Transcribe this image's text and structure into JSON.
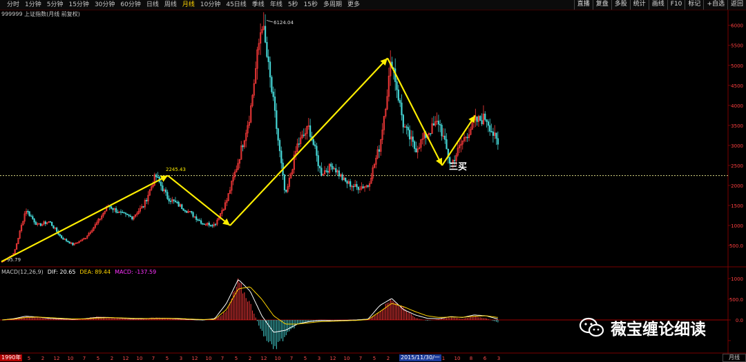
{
  "toolbar": {
    "tabs": [
      "分时",
      "1分钟",
      "5分钟",
      "15分钟",
      "30分钟",
      "60分钟",
      "日线",
      "周线",
      "月线",
      "10分钟",
      "45日线",
      "季线",
      "年线",
      "5秒",
      "15秒",
      "多周期",
      "更多"
    ],
    "active_tab": "月线",
    "right_buttons": [
      "直播",
      "复盘",
      "多股",
      "统计",
      "画线",
      "F10",
      "标记",
      "+自选",
      "返回"
    ]
  },
  "chart_title": "999999 上证指数(月线 前复权)",
  "macd_legend": {
    "label": "MACD(12,26,9)",
    "dif": "DIF: 20.65",
    "dea": "DEA: 89.44",
    "macd": "MACD: -137.59"
  },
  "watermark": "薇宝缠论细读",
  "period_label": "月线",
  "start_label": "1990年",
  "cursor_date": "2015/11/30/一",
  "colors": {
    "up": "#ff3b3b",
    "down": "#45d3d3",
    "arrow": "#ffee00",
    "dif": "#ffffff",
    "dea": "#ffd400",
    "macd_text": "#ff33ff",
    "grid": "#7a0000"
  },
  "chart_data": [
    {
      "type": "candlestick",
      "title": "999999 上证指数(月线 前复权)",
      "yticks": [
        500,
        1000,
        1500,
        2000,
        2500,
        3000,
        3500,
        4000,
        4500,
        5000,
        5500,
        6000
      ],
      "ytick_labels": [
        "500.0",
        "1000",
        "1500",
        "2000",
        "2500",
        "3000",
        "3500",
        "4000",
        "4500",
        "5000",
        "5500",
        "6000"
      ],
      "ylim": [
        0,
        6150
      ],
      "xtick_labels": [
        "1990年",
        "7",
        "5",
        "2",
        "12",
        "10",
        "7",
        "5",
        "2",
        "12",
        "10",
        "7",
        "5",
        "3",
        "12",
        "10",
        "7",
        "5",
        "2",
        "12",
        "10",
        "7",
        "5",
        "3",
        "12",
        "10",
        "7",
        "5",
        "2",
        "12",
        "2015/11/30/一",
        "3",
        "1",
        "10",
        "8",
        "6",
        "3"
      ],
      "price_path": [
        96,
        300,
        1400,
        1000,
        1100,
        700,
        520,
        680,
        1050,
        1500,
        1300,
        1200,
        1500,
        2245,
        1700,
        1500,
        1300,
        1050,
        1020,
        1600,
        2600,
        3800,
        6124,
        4000,
        1700,
        3000,
        3450,
        2300,
        2500,
        2100,
        1950,
        2000,
        3000,
        5178,
        3500,
        2900,
        3300,
        3600,
        2500,
        3100,
        3580,
        3700,
        3000
      ],
      "annotations": [
        {
          "text": "6124.04",
          "value": 6124.04
        },
        {
          "text": "2245.43",
          "value": 2245.43
        },
        {
          "text": "95.79",
          "value": 95.79
        },
        {
          "text": "三买"
        }
      ],
      "reference_line": 2245.43,
      "arrows_path": [
        96,
        2245,
        1000,
        5178,
        2500,
        3750
      ]
    },
    {
      "type": "bar",
      "title": "MACD(12,26,9)",
      "yticks": [
        -500,
        0,
        500,
        1000
      ],
      "ytick_labels": [
        "",
        "0.0",
        "500.0",
        "1000"
      ],
      "ylim": [
        -800,
        1100
      ],
      "series": [
        {
          "name": "DIF"
        },
        {
          "name": "DEA"
        },
        {
          "name": "MACD"
        }
      ],
      "macd_path": [
        0,
        40,
        80,
        60,
        30,
        20,
        10,
        40,
        80,
        60,
        40,
        20,
        30,
        60,
        40,
        20,
        0,
        -10,
        20,
        200,
        900,
        400,
        -300,
        -700,
        -400,
        -100,
        -50,
        -30,
        -20,
        -10,
        -20,
        10,
        200,
        500,
        300,
        50,
        -20,
        20,
        60,
        30,
        90,
        40,
        -60
      ],
      "dif_path": [
        0,
        30,
        90,
        70,
        40,
        25,
        15,
        30,
        60,
        60,
        45,
        30,
        30,
        40,
        40,
        25,
        10,
        0,
        30,
        400,
        980,
        700,
        100,
        -300,
        -250,
        -100,
        -40,
        -10,
        -20,
        -10,
        0,
        20,
        350,
        520,
        250,
        120,
        40,
        30,
        80,
        60,
        120,
        100,
        20
      ],
      "dea_path": [
        0,
        20,
        60,
        70,
        55,
        40,
        25,
        25,
        45,
        55,
        50,
        40,
        35,
        35,
        40,
        35,
        20,
        10,
        15,
        250,
        750,
        800,
        500,
        100,
        -100,
        -100,
        -70,
        -40,
        -30,
        -20,
        -10,
        10,
        200,
        400,
        320,
        200,
        100,
        60,
        70,
        65,
        90,
        100,
        60
      ]
    }
  ]
}
